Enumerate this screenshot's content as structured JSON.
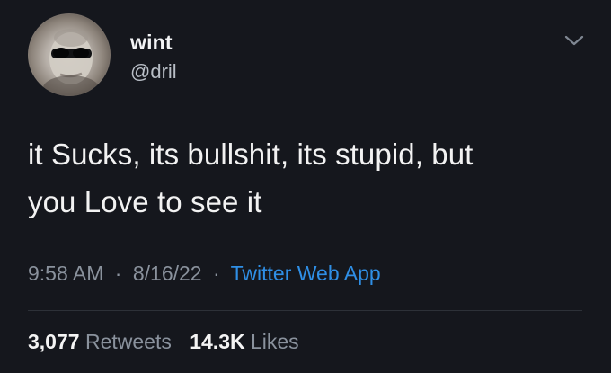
{
  "user": {
    "display_name": "wint",
    "handle": "@dril"
  },
  "tweet": {
    "line1": "it Sucks, its bullshit, its stupid, but",
    "line2": "you Love to see it",
    "time": "9:58 AM",
    "separator": "·",
    "date": "8/16/22",
    "source": "Twitter Web App"
  },
  "stats": {
    "retweets_value": "3,077",
    "retweets_label": "Retweets",
    "likes_value": "14.3K",
    "likes_label": "Likes"
  },
  "icons": {
    "menu": "chevron-down-icon"
  }
}
